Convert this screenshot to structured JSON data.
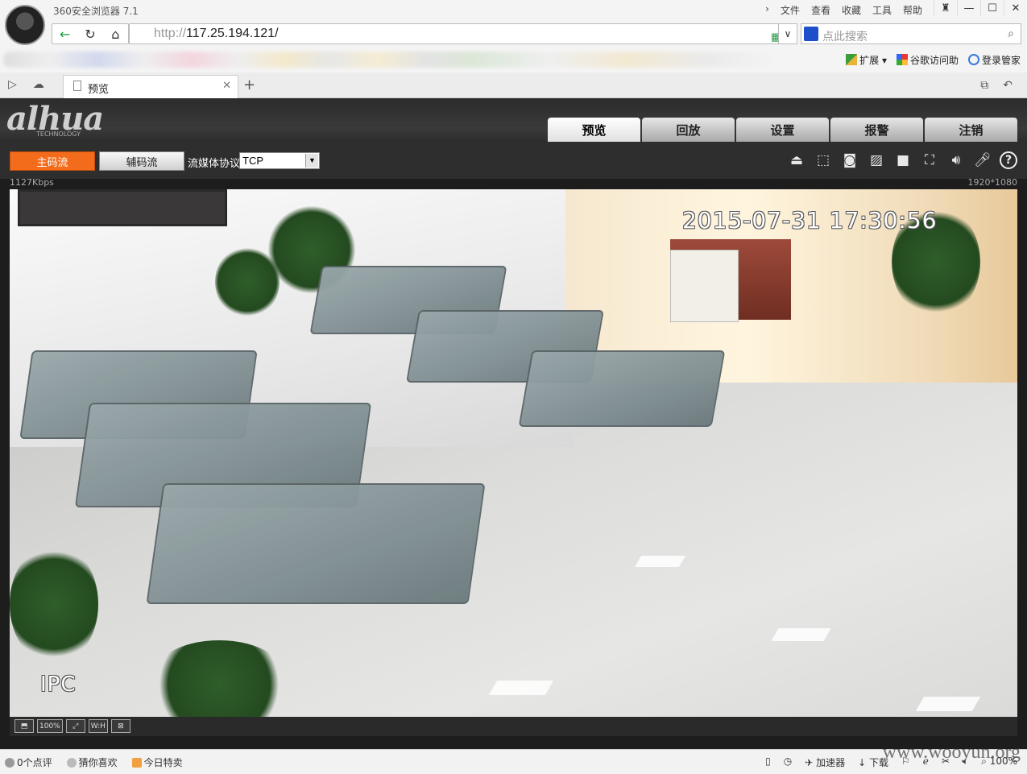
{
  "browser": {
    "app_title": "360安全浏览器 7.1",
    "menu": [
      "文件",
      "查看",
      "收藏",
      "工具",
      "帮助"
    ],
    "window_buttons": [
      "shirt-icon",
      "minimize-icon",
      "maximize-icon",
      "close-icon"
    ],
    "url_scheme": "http://",
    "url_host": "117.25.194.121/",
    "search_placeholder": "点此搜索",
    "bookmarks_right": [
      "扩展",
      "谷歌访问助",
      "登录管家"
    ],
    "tab_label": "预览",
    "tab_new": "+"
  },
  "app": {
    "logo": "alhua",
    "logo_sub": "TECHNOLOGY",
    "nav_tabs": [
      "预览",
      "回放",
      "设置",
      "报警",
      "注销"
    ],
    "active_tab": "预览",
    "main_stream": "主码流",
    "sub_stream": "辅码流",
    "protocol_label": "流媒体协议",
    "protocol_value": "TCP",
    "bitrate": "1127Kbps",
    "resolution": "1920*1080",
    "osd_time": "2015-07-31 17:30:56",
    "osd_name": "IPC",
    "video_controls": [
      "restore-icon",
      "100%",
      "fullscreen-icon",
      "W:H",
      "fit-icon"
    ],
    "accent_color": "#f36c1c"
  },
  "status": {
    "left": [
      "0个点评",
      "猜你喜欢",
      "今日特卖"
    ],
    "right": [
      "加速器",
      "下载",
      "100%"
    ],
    "watermark": "www.wooyun.org"
  }
}
